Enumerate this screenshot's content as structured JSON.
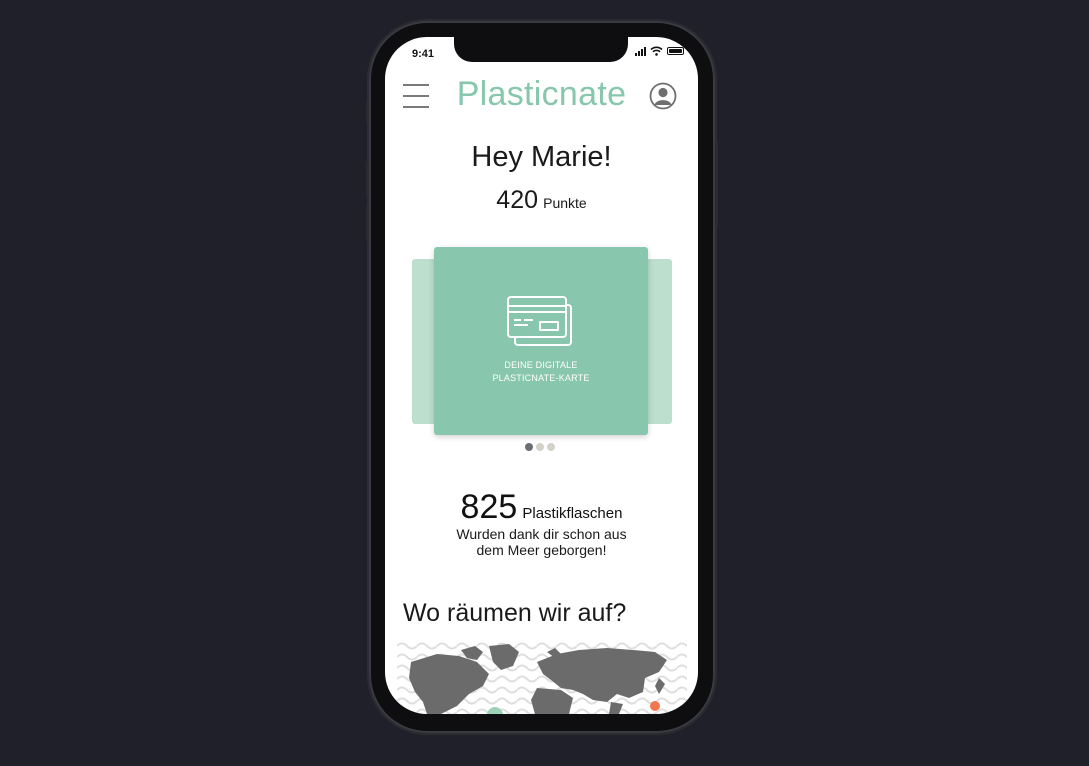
{
  "status_bar": {
    "time": "9:41"
  },
  "header": {
    "title": "Plasticnate",
    "title_color": "#86c7ad"
  },
  "greeting": "Hey Marie!",
  "points": {
    "value": "420",
    "label": "Punkte"
  },
  "card": {
    "line1": "DEINE DIGITALE",
    "line2": "PLASTICNATE-KARTE",
    "color": "#88c6ae",
    "carousel_count": 3,
    "carousel_active": 1
  },
  "bottles": {
    "count": "825",
    "label": "Plastikflaschen",
    "desc_line1": "Wurden dank dir schon aus",
    "desc_line2": "dem Meer geborgen!"
  },
  "map_section": {
    "title": "Wo räumen wir auf?"
  },
  "icons": [
    "menu-icon",
    "profile-icon",
    "card-icon",
    "signal-icon",
    "wifi-icon",
    "battery-icon"
  ]
}
